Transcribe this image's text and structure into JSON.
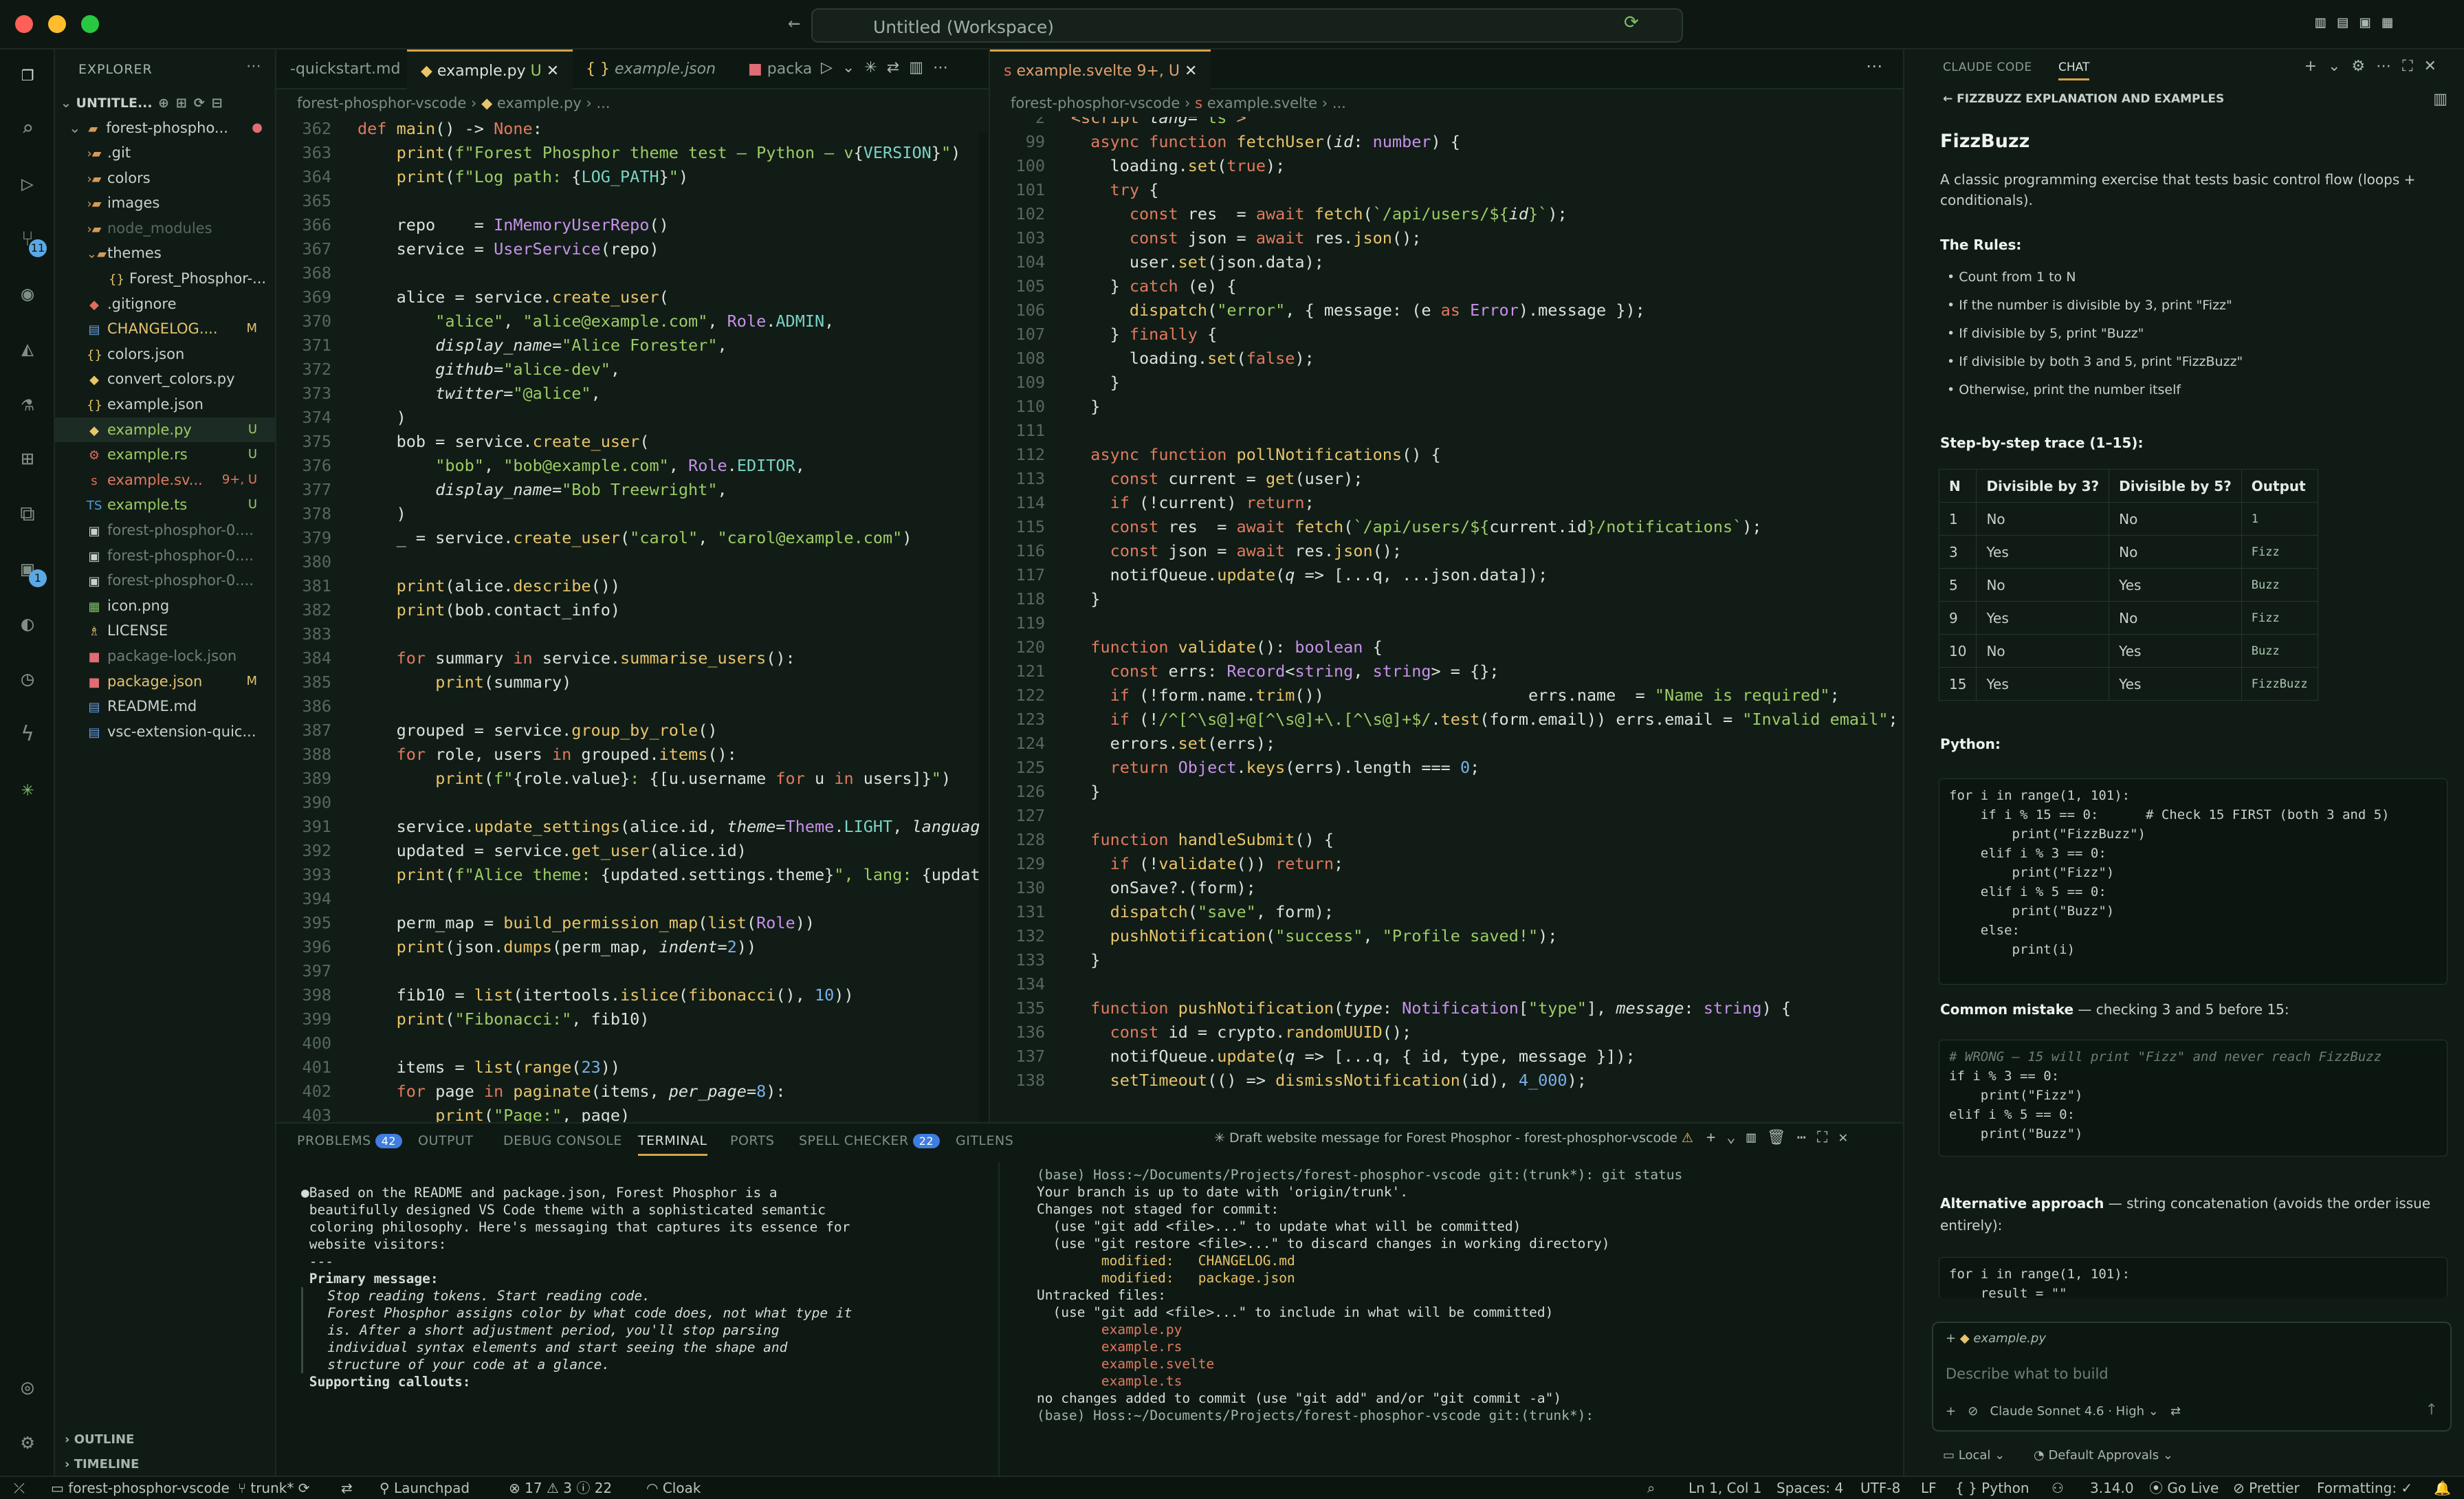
{
  "window": {
    "title": "Untitled (Workspace)"
  },
  "explorer": {
    "title": "EXPLORER",
    "workspace": "UNTITLE...",
    "root": "forest-phospho...",
    "items": [
      {
        "name": ".git",
        "kind": "folder",
        "status": ""
      },
      {
        "name": "colors",
        "kind": "folder",
        "status": ""
      },
      {
        "name": "images",
        "kind": "folder",
        "status": ""
      },
      {
        "name": "node_modules",
        "kind": "folder",
        "status": ""
      },
      {
        "name": "themes",
        "kind": "folder-open",
        "status": ""
      },
      {
        "name": "Forest_Phosphor-...",
        "kind": "json",
        "status": ""
      },
      {
        "name": ".gitignore",
        "kind": "git",
        "status": ""
      },
      {
        "name": "CHANGELOG....",
        "kind": "md",
        "status": "M"
      },
      {
        "name": "colors.json",
        "kind": "json",
        "status": ""
      },
      {
        "name": "convert_colors.py",
        "kind": "py",
        "status": ""
      },
      {
        "name": "example.json",
        "kind": "json",
        "status": ""
      },
      {
        "name": "example.py",
        "kind": "py",
        "status": "U"
      },
      {
        "name": "example.rs",
        "kind": "rs",
        "status": "U"
      },
      {
        "name": "example.sv...",
        "kind": "svelte",
        "status": "9+, U"
      },
      {
        "name": "example.ts",
        "kind": "ts",
        "status": "U"
      },
      {
        "name": "forest-phosphor-0....",
        "kind": "vsix",
        "status": ""
      },
      {
        "name": "forest-phosphor-0....",
        "kind": "vsix",
        "status": ""
      },
      {
        "name": "forest-phosphor-0....",
        "kind": "vsix",
        "status": ""
      },
      {
        "name": "icon.png",
        "kind": "img",
        "status": ""
      },
      {
        "name": "LICENSE",
        "kind": "license",
        "status": ""
      },
      {
        "name": "package-lock.json",
        "kind": "npm",
        "status": ""
      },
      {
        "name": "package.json",
        "kind": "npm",
        "status": "M"
      },
      {
        "name": "README.md",
        "kind": "md",
        "status": ""
      },
      {
        "name": "vsc-extension-quic...",
        "kind": "md",
        "status": ""
      }
    ],
    "outline": "OUTLINE",
    "timeline": "TIMELINE"
  },
  "left_editor": {
    "tabs": [
      {
        "label": "-quickstart.md",
        "active": false
      },
      {
        "label": "example.py",
        "status": "U",
        "active": true
      },
      {
        "label": "example.json",
        "active": false
      },
      {
        "label": "packa",
        "active": false
      }
    ],
    "breadcrumb": [
      "forest-phosphor-vscode",
      "example.py",
      "..."
    ]
  },
  "right_editor": {
    "tabs": [
      {
        "label": "example.svelte",
        "status": "9+, U",
        "active": true
      }
    ],
    "breadcrumb": [
      "forest-phosphor-vscode",
      "example.svelte",
      "..."
    ],
    "sticky": "<script lang=\"ts\">"
  },
  "panel": {
    "tabs": [
      {
        "label": "PROBLEMS",
        "badge": "42"
      },
      {
        "label": "OUTPUT"
      },
      {
        "label": "DEBUG CONSOLE"
      },
      {
        "label": "TERMINAL",
        "active": true
      },
      {
        "label": "PORTS"
      },
      {
        "label": "SPELL CHECKER",
        "badge": "22"
      },
      {
        "label": "GITLENS"
      }
    ],
    "terminal_title": "✳ Draft website message for Forest Phosphor - forest-phosphor-vscode",
    "claude_output": [
      "●Based on the README and package.json, Forest Phosphor is a",
      " beautifully designed VS Code theme with a sophisticated semantic",
      " coloring philosophy. Here's messaging that captures its essence for",
      " website visitors:",
      "",
      " ---",
      " Primary message:",
      "",
      "   Stop reading tokens. Start reading code.",
      "",
      "   Forest Phosphor assigns color by what code does, not what type it",
      "   is. After a short adjustment period, you'll stop parsing",
      "   individual syntax elements and start seeing the shape and",
      "   structure of your code at a glance.",
      "",
      " Supporting callouts:"
    ],
    "git_output": [
      "(base) Hoss:~/Documents/Projects/forest-phosphor-vscode git:(trunk*): git status",
      "Your branch is up to date with 'origin/trunk'.",
      "",
      "Changes not staged for commit:",
      "  (use \"git add <file>...\" to update what will be committed)",
      "  (use \"git restore <file>...\" to discard changes in working directory)",
      "        modified:   CHANGELOG.md",
      "        modified:   package.json",
      "",
      "Untracked files:",
      "  (use \"git add <file>...\" to include in what will be committed)",
      "        example.py",
      "        example.rs",
      "        example.svelte",
      "        example.ts",
      "",
      "no changes added to commit (use \"git add\" and/or \"git commit -a\")",
      "(base) Hoss:~/Documents/Projects/forest-phosphor-vscode git:(trunk*): "
    ]
  },
  "chat": {
    "tabs": [
      "CLAUDE CODE",
      "CHAT"
    ],
    "header": "FIZZBUZZ EXPLANATION AND EXAMPLES",
    "title": "FizzBuzz",
    "intro": "A classic programming exercise that tests basic control flow (loops + conditionals).",
    "rules_heading": "The Rules:",
    "rules": [
      "Count from 1 to N",
      "If the number is divisible by 3, print \"Fizz\"",
      "If divisible by 5, print \"Buzz\"",
      "If divisible by both 3 and 5, print \"FizzBuzz\"",
      "Otherwise, print the number itself"
    ],
    "trace_heading": "Step-by-step trace (1–15):",
    "table_headers": [
      "N",
      "Divisible by 3?",
      "Divisible by 5?",
      "Output"
    ],
    "table_rows": [
      [
        "1",
        "No",
        "No",
        "1"
      ],
      [
        "3",
        "Yes",
        "No",
        "Fizz"
      ],
      [
        "5",
        "No",
        "Yes",
        "Buzz"
      ],
      [
        "9",
        "Yes",
        "No",
        "Fizz"
      ],
      [
        "10",
        "No",
        "Yes",
        "Buzz"
      ],
      [
        "15",
        "Yes",
        "Yes",
        "FizzBuzz"
      ]
    ],
    "python_heading": "Python:",
    "python_code": [
      "for i in range(1, 101):",
      "    if i % 15 == 0:      # Check 15 FIRST (both 3 and 5)",
      "        print(\"FizzBuzz\")",
      "    elif i % 3 == 0:",
      "        print(\"Fizz\")",
      "    elif i % 5 == 0:",
      "        print(\"Buzz\")",
      "    else:",
      "        print(i)"
    ],
    "mistake_heading": "Common mistake",
    "mistake_text": " — checking 3 and 5 before 15:",
    "mistake_code": [
      "# WRONG — 15 will print \"Fizz\" and never reach FizzBuzz",
      "if i % 3 == 0:",
      "    print(\"Fizz\")",
      "elif i % 5 == 0:",
      "    print(\"Buzz\")"
    ],
    "alt_heading": "Alternative approach",
    "alt_text": " — string concatenation (avoids the order issue entirely):",
    "alt_code": [
      "for i in range(1, 101):",
      "    result = \"\""
    ],
    "context_file": "example.py",
    "input_placeholder": "Describe what to build",
    "model": "Claude Sonnet 4.6 · High",
    "local": "Local",
    "approvals": "Default Approvals"
  },
  "status": {
    "repo": "forest-phosphor-vscode",
    "branch": "trunk*",
    "launchpad": "Launchpad",
    "errors": "17",
    "warnings": "3",
    "infos": "22",
    "cloak": "Cloak",
    "position": "Ln 1, Col 1",
    "spaces": "Spaces: 4",
    "encoding": "UTF-8",
    "eol": "LF",
    "language": "Python",
    "version": "3.14.0",
    "golive": "Go Live",
    "prettier": "Prettier",
    "formatting": "Formatting: ✓"
  },
  "colors": {
    "accent": "#d8a349",
    "background": "#111c16",
    "keyword": "#e07a5f",
    "function": "#e8c46a",
    "string": "#9ccc65",
    "number": "#7ab0e8"
  }
}
